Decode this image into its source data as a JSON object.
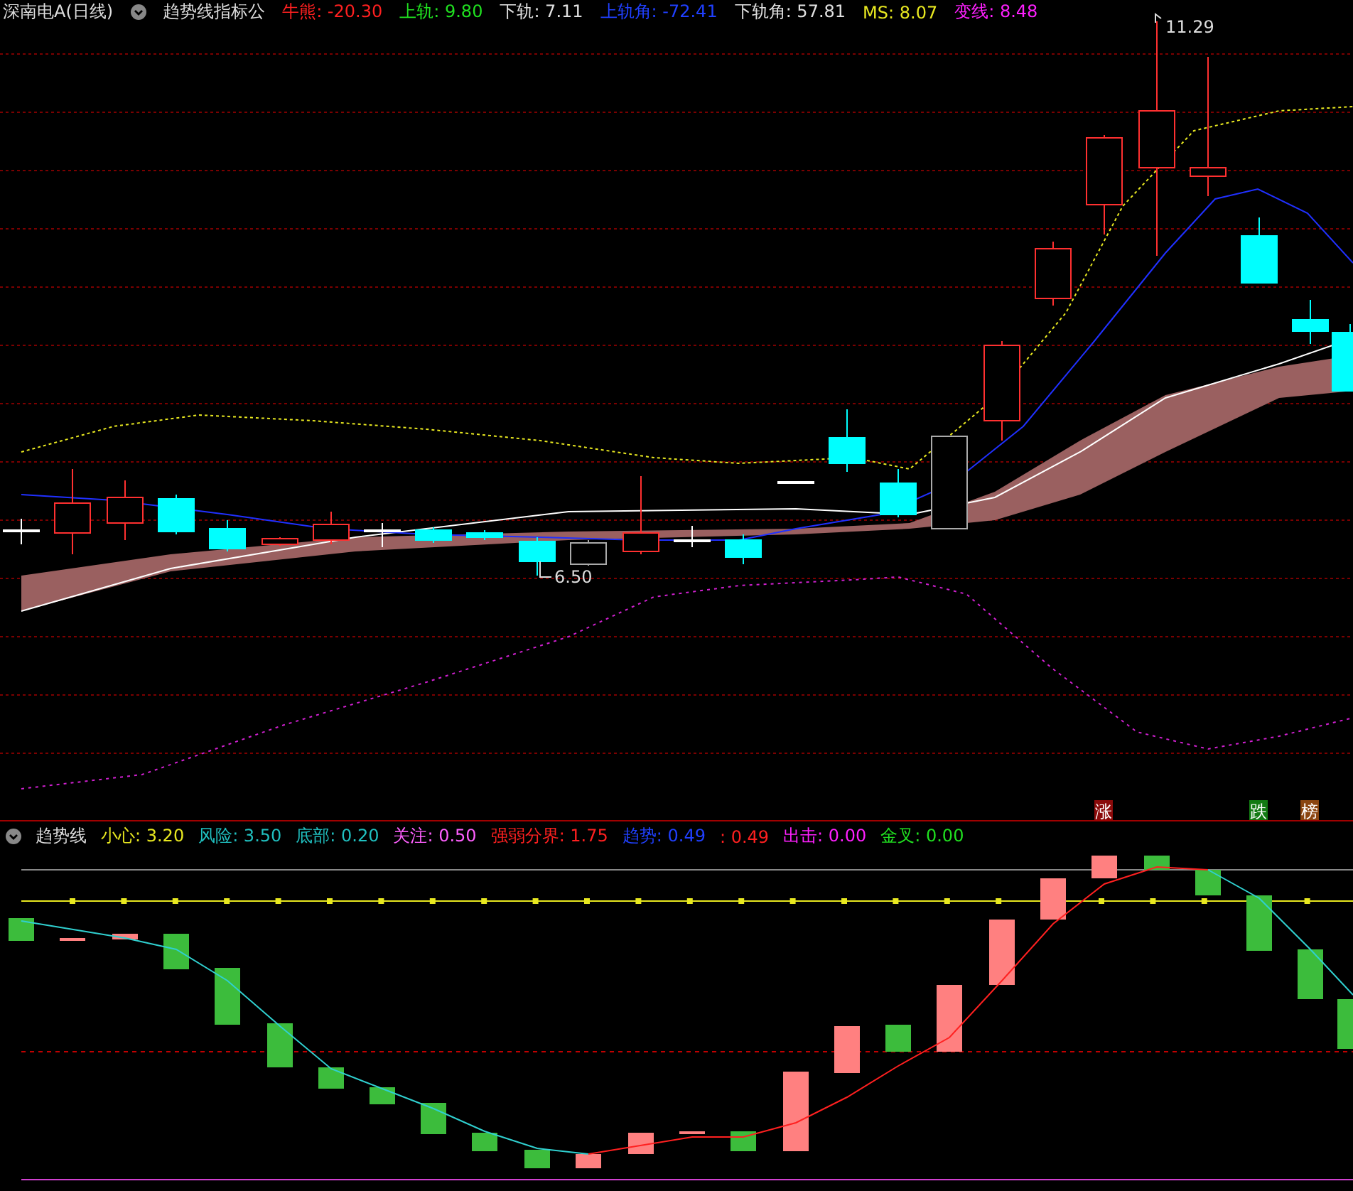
{
  "title_bar": {
    "security": "深南电A(日线)",
    "indicator_name": "趋势线指标公"
  },
  "main_legend": [
    {
      "label": "牛熊:",
      "value": "-20.30",
      "color": "#ff2020"
    },
    {
      "label": "上轨:",
      "value": "9.80",
      "color": "#20e020"
    },
    {
      "label": "下轨:",
      "value": "7.11",
      "color": "#e0e0e0"
    },
    {
      "label": "上轨角:",
      "value": "-72.41",
      "color": "#2040ff"
    },
    {
      "label": "下轨角:",
      "value": "57.81",
      "color": "#e0e0e0"
    },
    {
      "label": "MS:",
      "value": "8.07",
      "color": "#e8e820"
    },
    {
      "label": "变线:",
      "value": "8.48",
      "color": "#ff20ff"
    }
  ],
  "price_labels": [
    "11.29",
    "6.50"
  ],
  "signal_badges": [
    {
      "text": "涨",
      "color": "#8b0a0a"
    },
    {
      "text": "跌",
      "color": "#127a12"
    },
    {
      "text": "榜",
      "color": "#8a4510"
    }
  ],
  "indicator": {
    "name": "趋势线",
    "legend": [
      {
        "label": "小心:",
        "value": "3.20",
        "color": "#e8e820"
      },
      {
        "label": "风险:",
        "value": "3.50",
        "color": "#20c0c0"
      },
      {
        "label": "底部:",
        "value": "0.20",
        "color": "#20c0c0"
      },
      {
        "label": "关注:",
        "value": "0.50",
        "color": "#ff60ff"
      },
      {
        "label": "强弱分界:",
        "value": "1.75",
        "color": "#ff2020"
      },
      {
        "label": "趋势:",
        "value": "0.49",
        "color": "#2040ff"
      },
      {
        "value": ": 0.49",
        "color": "#ff2020"
      },
      {
        "label": "出击:",
        "value": "0.00",
        "color": "#ff20ff"
      },
      {
        "label": "金叉:",
        "value": "0.00",
        "color": "#20e020"
      }
    ]
  }
}
